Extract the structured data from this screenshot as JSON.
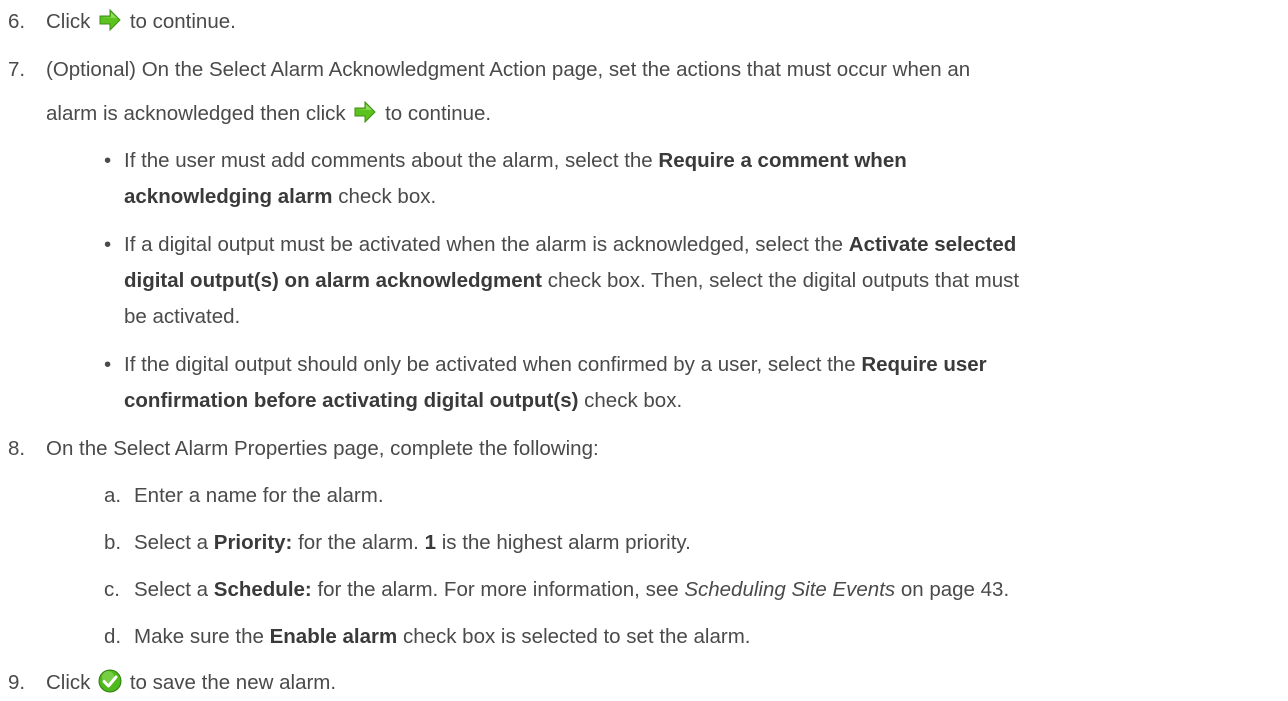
{
  "steps": [
    {
      "num": "6.",
      "pre": "Click",
      "post": "to continue."
    },
    {
      "num": "7.",
      "line1": "(Optional) On the Select Alarm Acknowledgment Action page, set the actions that must occur when an",
      "line2_pre": "alarm is acknowledged then click",
      "line2_post": "to continue."
    },
    {
      "num": "8.",
      "text": "On the Select Alarm Properties page, complete the following:"
    },
    {
      "num": "9.",
      "pre": "Click",
      "post": "to save the new alarm."
    }
  ],
  "bullets": [
    {
      "a": "If the user must add comments about the alarm, select the",
      "b1": "Require a comment when",
      "b2": "acknowledging alarm",
      "c": "check box."
    },
    {
      "a": "If a digital output must be activated when the alarm is acknowledged, select the",
      "b1": "Activate selected",
      "b2": "digital output(s) on alarm acknowledgment",
      "c": "check box. Then, select the digital outputs that must",
      "d": "be activated."
    },
    {
      "a": "If the digital output should only be activated when confirmed by a user, select the",
      "b1": "Require user",
      "b2": "confirmation before activating digital output(s)",
      "c": "check box."
    }
  ],
  "substeps": [
    {
      "letter": "a.",
      "text": "Enter a name for the alarm."
    },
    {
      "letter": "b.",
      "pre": "Select a",
      "bold": "Priority:",
      "mid": "for the alarm.",
      "bold2": "1",
      "post": "is the highest alarm priority."
    },
    {
      "letter": "c.",
      "pre": "Select a",
      "bold": "Schedule:",
      "mid": "for the alarm. For more information, see",
      "italic": "Scheduling Site Events",
      "post": "on page 43."
    },
    {
      "letter": "d.",
      "pre": "Make sure the",
      "bold": "Enable alarm",
      "post": "check box is selected to set the alarm."
    }
  ],
  "bullet_char": "•",
  "icons": {
    "next": "green-arrow-icon",
    "save": "green-checkmark-icon"
  },
  "colors": {
    "arrow": "#5cc21e",
    "check": "#4fb81c"
  }
}
